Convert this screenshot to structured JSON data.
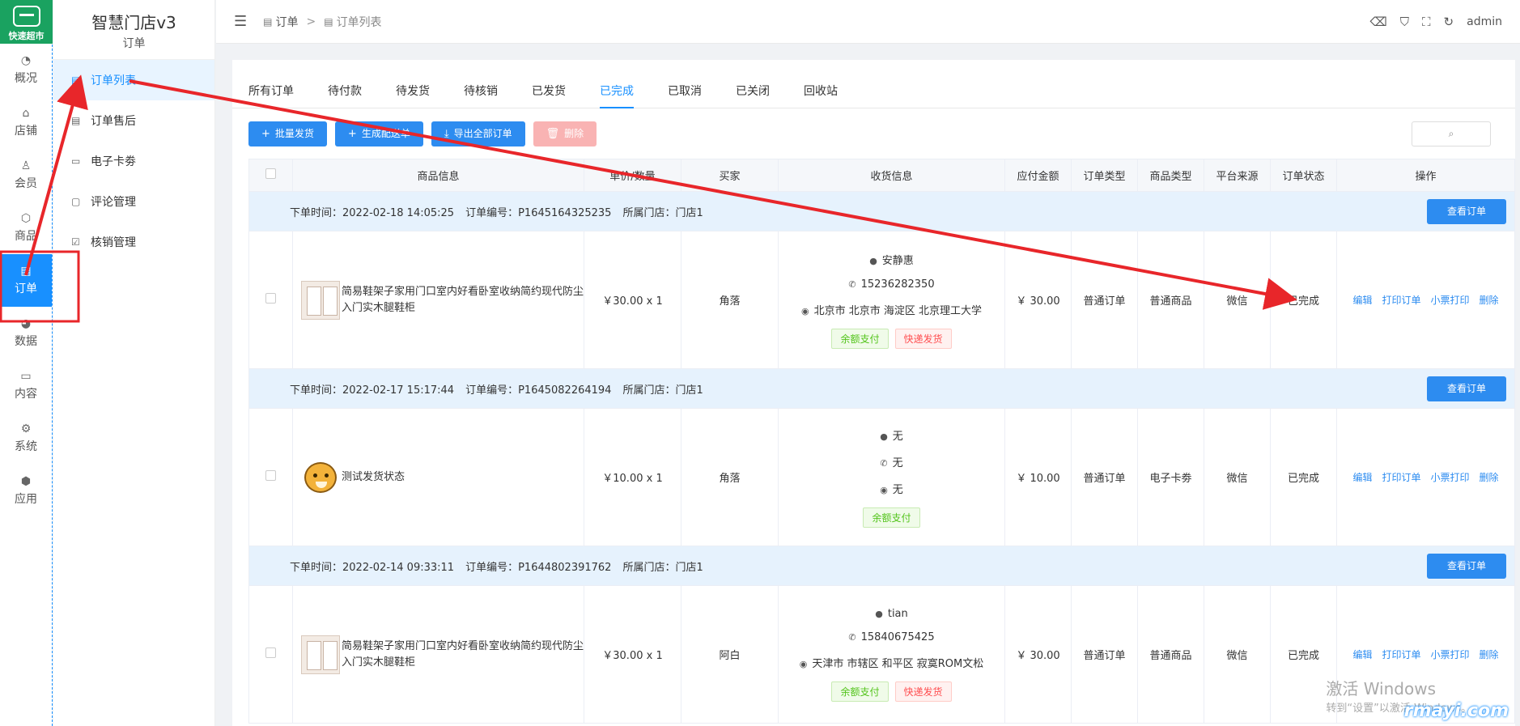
{
  "logo": {
    "text": "快速超市"
  },
  "rail": [
    {
      "label": "概况",
      "icon": "dashboard-icon"
    },
    {
      "label": "店铺",
      "icon": "shop-icon"
    },
    {
      "label": "会员",
      "icon": "user-icon"
    },
    {
      "label": "商品",
      "icon": "box-icon"
    },
    {
      "label": "订单",
      "icon": "clipboard-icon",
      "active": true
    },
    {
      "label": "数据",
      "icon": "pie-chart-icon"
    },
    {
      "label": "内容",
      "icon": "folder-icon"
    },
    {
      "label": "系统",
      "icon": "gear-icon"
    },
    {
      "label": "应用",
      "icon": "cube-icon"
    }
  ],
  "subnav": {
    "store_title": "智慧门店v3",
    "section": "订单",
    "items": [
      {
        "label": "订单列表",
        "icon": "clipboard-icon",
        "active": true
      },
      {
        "label": "订单售后",
        "icon": "clipboard-icon"
      },
      {
        "label": "电子卡劵",
        "icon": "card-icon"
      },
      {
        "label": "评论管理",
        "icon": "comment-icon"
      },
      {
        "label": "核销管理",
        "icon": "check-square-icon"
      }
    ]
  },
  "header": {
    "breadcrumb": [
      "订单",
      "订单列表"
    ],
    "breadcrumb_sep": ">",
    "user": "admin"
  },
  "tabs": [
    "所有订单",
    "待付款",
    "待发货",
    "待核销",
    "已发货",
    "已完成",
    "已取消",
    "已关闭",
    "回收站"
  ],
  "active_tab": "已完成",
  "toolbar": {
    "batch_ship": "批量发货",
    "gen_delivery": "生成配送单",
    "export_all": "导出全部订单",
    "delete": "删除"
  },
  "table": {
    "columns": [
      "商品信息",
      "单价/数量",
      "买家",
      "收货信息",
      "应付金额",
      "订单类型",
      "商品类型",
      "平台来源",
      "订单状态",
      "操作"
    ],
    "view_label": "查看订单",
    "ops": [
      "编辑",
      "打印订单",
      "小票打印",
      "删除"
    ],
    "orders": [
      {
        "time": "下单时间：2022-02-18 14:05:25",
        "no": "订单编号：P1645164325235",
        "store": "所属门店：门店1",
        "goods": "简易鞋架子家用门口室内好看卧室收纳简约现代防尘入门实木腿鞋柜",
        "thumb": "shelf",
        "price_qty": "￥30.00 x 1",
        "buyer": "角落",
        "recv_name": "安静惠",
        "recv_phone": "15236282350",
        "recv_addr": "北京市 北京市 海淀区 北京理工大学",
        "tags": [
          {
            "text": "余额支付",
            "color": "green"
          },
          {
            "text": "快递发货",
            "color": "red"
          }
        ],
        "amount": "￥ 30.00",
        "order_type": "普通订单",
        "goods_type": "普通商品",
        "source": "微信",
        "status": "已完成"
      },
      {
        "time": "下单时间：2022-02-17 15:17:44",
        "no": "订单编号：P1645082264194",
        "store": "所属门店：门店1",
        "goods": "测试发货状态",
        "thumb": "tiger",
        "price_qty": "￥10.00 x 1",
        "buyer": "角落",
        "recv_name": "无",
        "recv_phone": "无",
        "recv_addr": "无",
        "tags": [
          {
            "text": "余额支付",
            "color": "green"
          }
        ],
        "amount": "￥ 10.00",
        "order_type": "普通订单",
        "goods_type": "电子卡劵",
        "source": "微信",
        "status": "已完成"
      },
      {
        "time": "下单时间：2022-02-14 09:33:11",
        "no": "订单编号：P1644802391762",
        "store": "所属门店：门店1",
        "goods": "简易鞋架子家用门口室内好看卧室收纳简约现代防尘入门实木腿鞋柜",
        "thumb": "shelf",
        "price_qty": "￥30.00 x 1",
        "buyer": "阿白",
        "recv_name": "tian",
        "recv_phone": "15840675425",
        "recv_addr": "天津市 市辖区 和平区 寂寞ROM文松",
        "tags": [
          {
            "text": "余额支付",
            "color": "green"
          },
          {
            "text": "快递发货",
            "color": "red"
          }
        ],
        "amount": "￥ 30.00",
        "order_type": "普通订单",
        "goods_type": "普通商品",
        "source": "微信",
        "status": "已完成"
      }
    ]
  },
  "watermark": {
    "title": "激活 Windows",
    "sub": "转到“设置”以激活 Windows。",
    "brand": "rmayi.com"
  },
  "colors": {
    "primary": "#1890ff",
    "button": "#2d8cf0",
    "success": "#52c41a",
    "annotation": "#e8262a"
  }
}
